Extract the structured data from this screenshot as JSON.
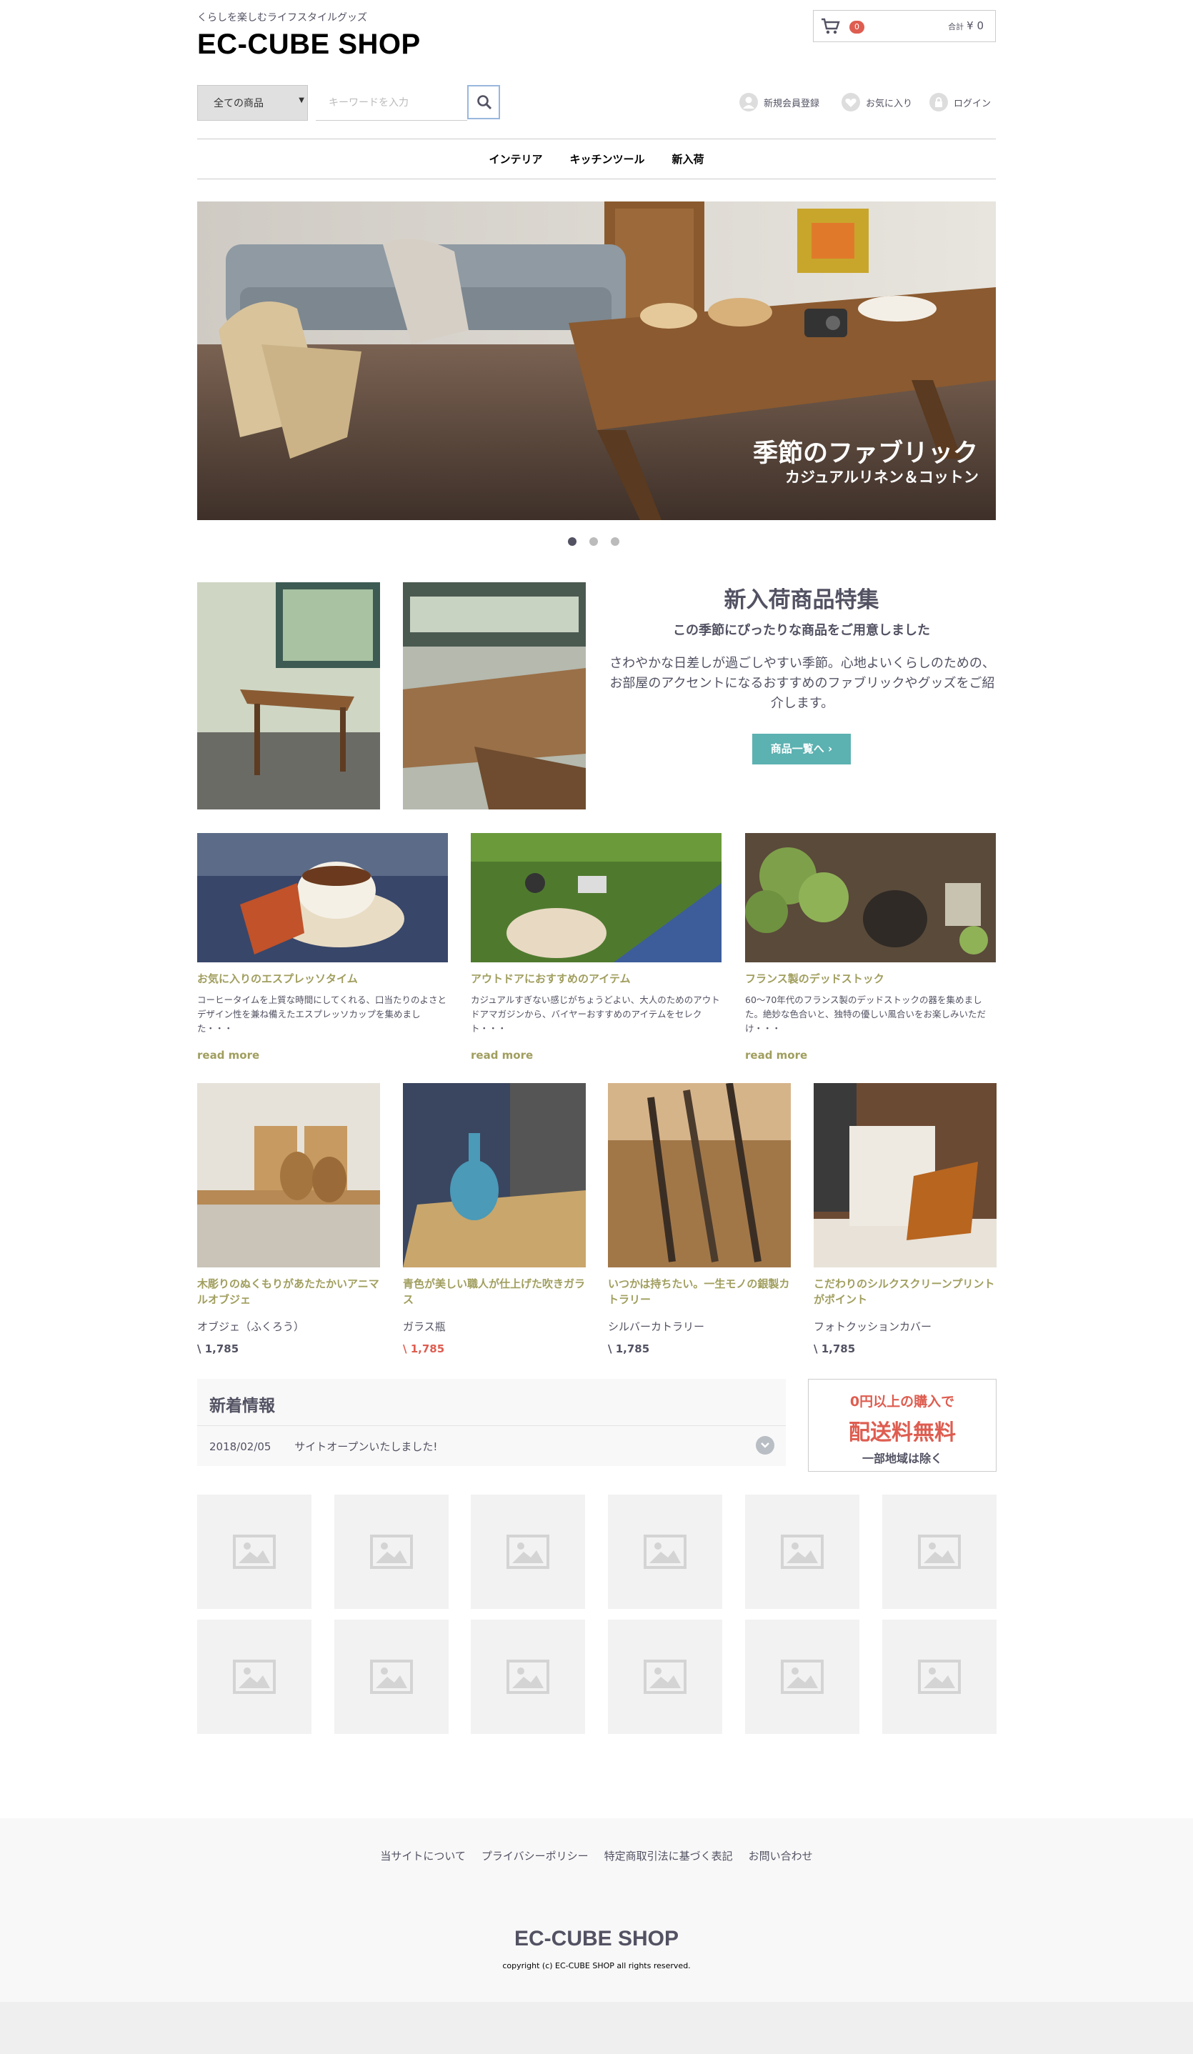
{
  "header": {
    "tagline": "くらしを楽しむライフスタイルグッズ",
    "logo": "EC-CUBE SHOP",
    "cart": {
      "count": "0",
      "total_label": "合計",
      "total": "¥ 0"
    },
    "search": {
      "category": "全ての商品",
      "placeholder": "キーワードを入力"
    },
    "links": [
      {
        "label": "新規会員登録",
        "icon": "user-icon"
      },
      {
        "label": "お気に入り",
        "icon": "heart-icon"
      },
      {
        "label": "ログイン",
        "icon": "lock-icon"
      }
    ]
  },
  "nav": {
    "items": [
      "インテリア",
      "キッチンツール",
      "新入荷"
    ]
  },
  "hero": {
    "caption_main": "季節のファブリック",
    "caption_sub": "カジュアルリネン＆コットン",
    "slides": 3,
    "active_slide": 1
  },
  "feature": {
    "title": "新入荷商品特集",
    "subtitle": "この季節にぴったりな商品をご用意しました",
    "body": "さわやかな日差しが過ごしやすい季節。心地よいくらしのための、お部屋のアクセントになるおすすめのファブリックやグッズをご紹介します。",
    "button": "商品一覧へ"
  },
  "articles": [
    {
      "title": "お気に入りのエスプレッソタイム",
      "text": "コーヒータイムを上質な時間にしてくれる、口当たりのよさとデザイン性を兼ね備えたエスプレッソカップを集めました・・・",
      "more": "read more"
    },
    {
      "title": "アウトドアにおすすめのアイテム",
      "text": "カジュアルすぎない感じがちょうどよい、大人のためのアウトドアマガジンから、バイヤーおすすめのアイテムをセレクト・・・",
      "more": "read more"
    },
    {
      "title": "フランス製のデッドストック",
      "text": "60～70年代のフランス製のデッドストックの器を集めました。絶妙な色合いと、独特の優しい風合いをお楽しみいただけ・・・",
      "more": "read more"
    }
  ],
  "products": [
    {
      "desc": "木彫りのぬくもりがあたたかいアニマルオブジェ",
      "name": "オブジェ（ふくろう）",
      "price": "\\ 1,785",
      "red": false
    },
    {
      "desc": "青色が美しい職人が仕上げた吹きガラス",
      "name": "ガラス瓶",
      "price": "\\ 1,785",
      "red": true
    },
    {
      "desc": "いつかは持ちたい。一生モノの銀製カトラリー",
      "name": "シルバーカトラリー",
      "price": "\\ 1,785",
      "red": false
    },
    {
      "desc": "こだわりのシルクスクリーンプリントがポイント",
      "name": "フォトクッションカバー",
      "price": "\\ 1,785",
      "red": false
    }
  ],
  "news": {
    "heading": "新着情報",
    "items": [
      {
        "date": "2018/02/05",
        "text": "サイトオープンいたしました!"
      }
    ]
  },
  "shipping": {
    "line1": "0円以上の購入で",
    "line2": "配送料無料",
    "line3": "一部地域は除く"
  },
  "footer": {
    "links": [
      "当サイトについて",
      "プライバシーポリシー",
      "特定商取引法に基づく表記",
      "お問い合わせ"
    ],
    "logo": "EC-CUBE SHOP",
    "copyright": "copyright (c) EC-CUBE SHOP all rights reserved."
  },
  "colors": {
    "accent_teal": "#5cb1b1",
    "accent_red": "#de5d50",
    "gold_text": "#a09e5e",
    "text": "#525263"
  }
}
